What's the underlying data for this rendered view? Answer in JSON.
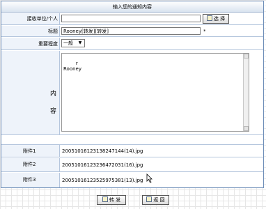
{
  "form": {
    "title": "输入您的通知内容",
    "recipient": {
      "label": "接收单位/个人",
      "value": "",
      "select_button": "选 择"
    },
    "subject": {
      "label": "标题",
      "value": "Rooney[转发][转发]",
      "required_mark": "*"
    },
    "importance": {
      "label": "重要程度",
      "selected": "一般"
    },
    "content": {
      "label_1": "内",
      "label_2": "容",
      "value": "r\nRooney"
    },
    "attachments": [
      {
        "label": "附件1",
        "filename": "20051016123138247144(14).jpg"
      },
      {
        "label": "附件2",
        "filename": "20051016123236472031(16).jpg"
      },
      {
        "label": "附件3",
        "filename": "20051016123525975381(13).jpg"
      }
    ]
  },
  "actions": {
    "forward": "转 发",
    "back": "返 回"
  }
}
